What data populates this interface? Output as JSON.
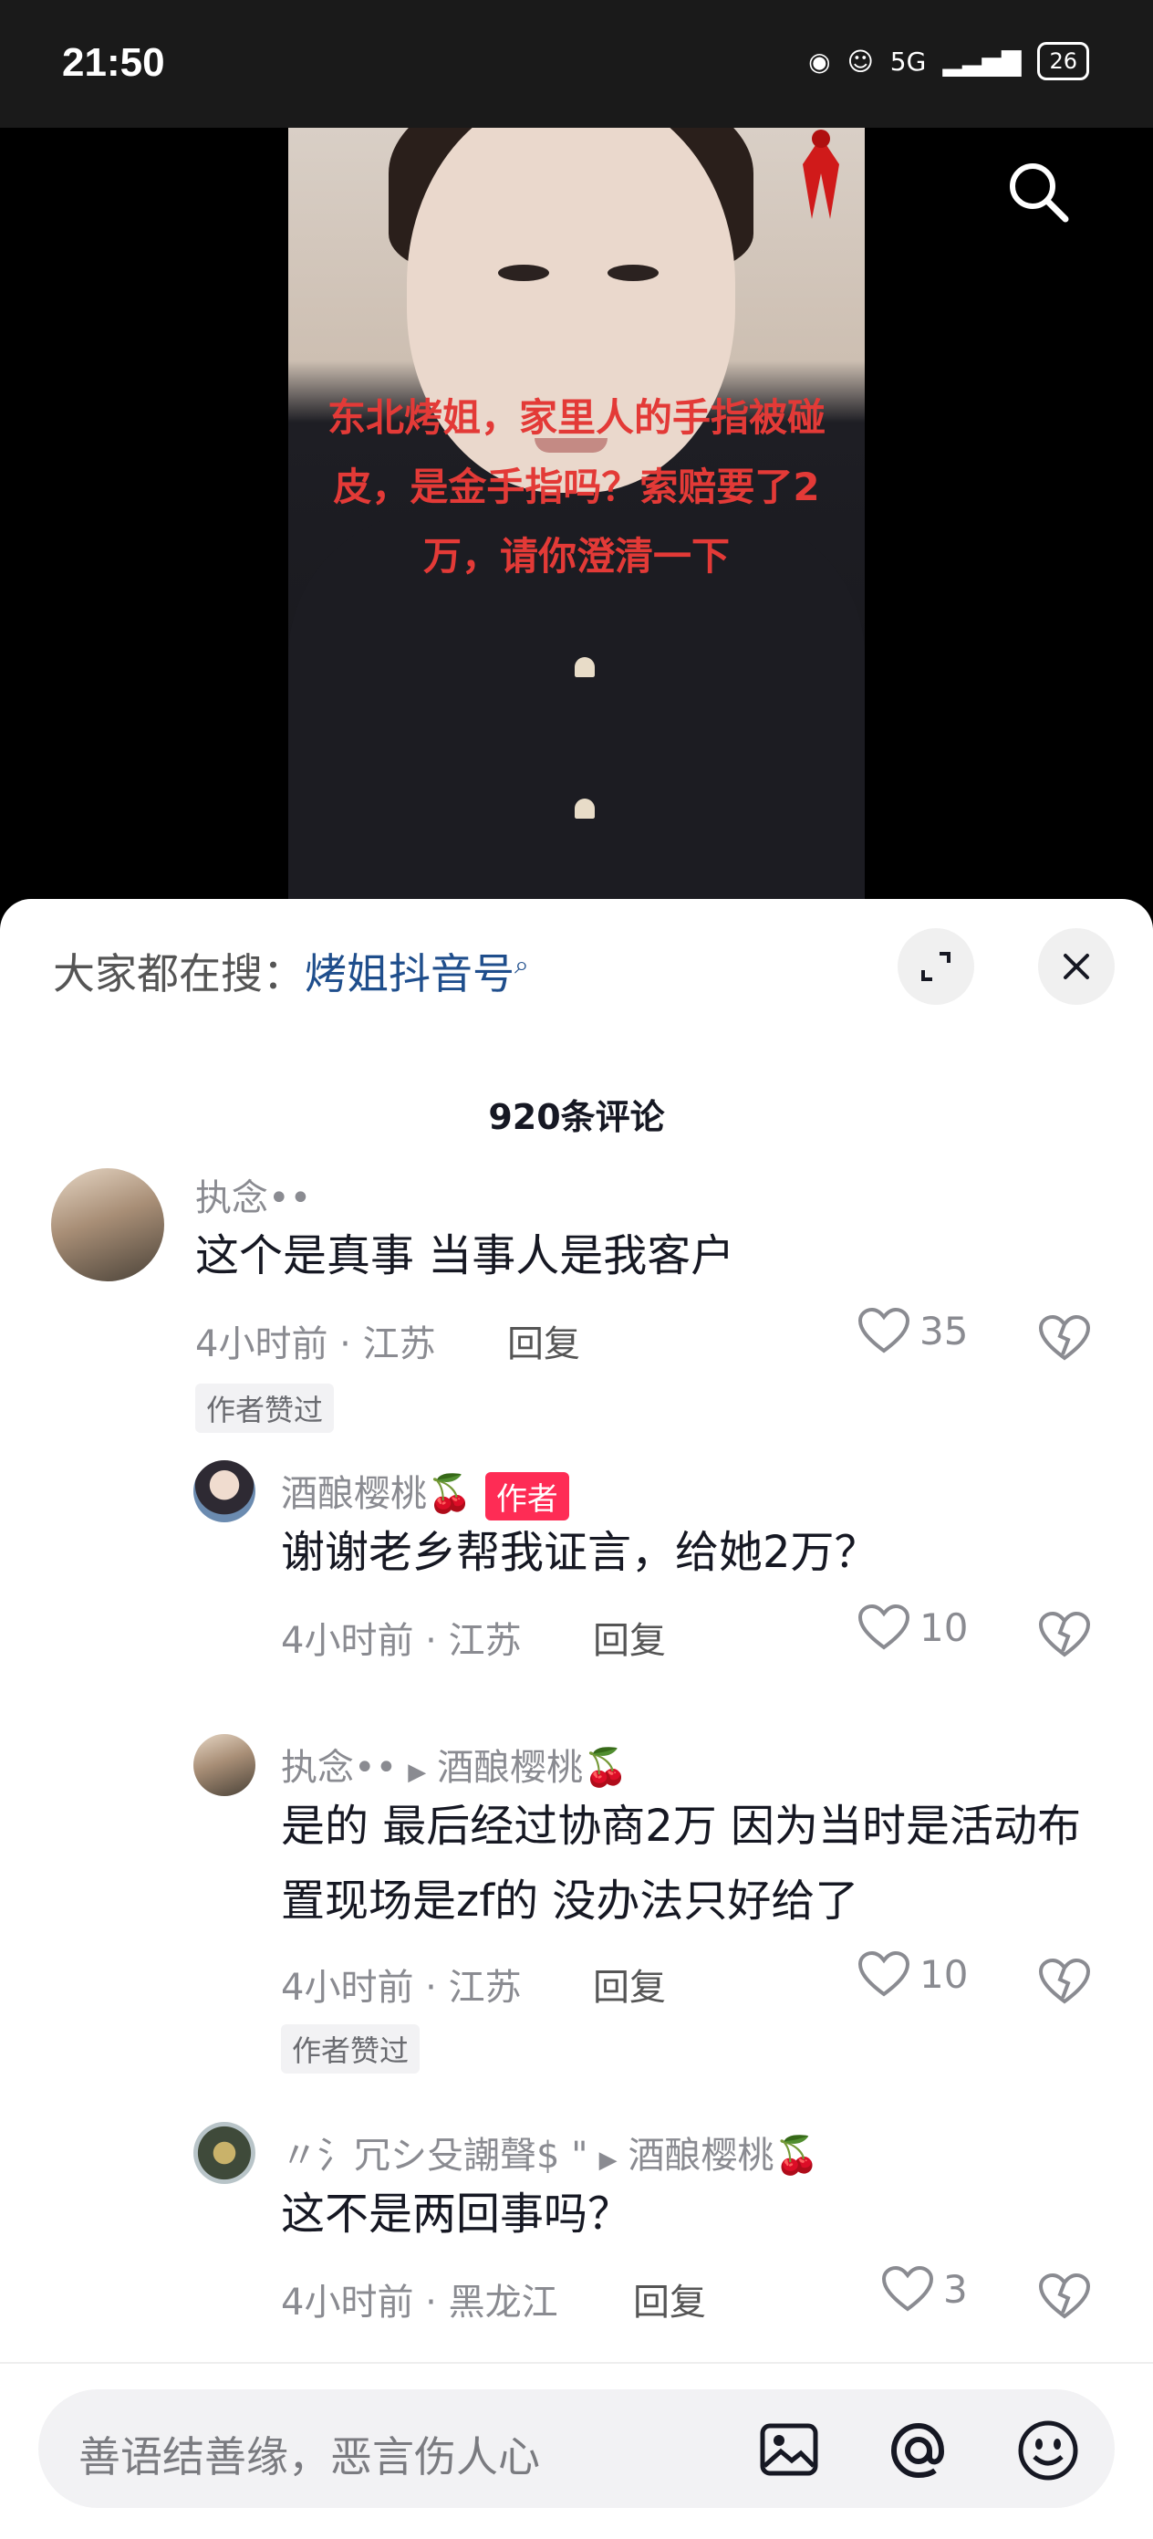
{
  "status_bar": {
    "time": "21:50",
    "icons": [
      "eye-icon",
      "cat-icon",
      "5g-signal-icon",
      "signal-bars-icon"
    ],
    "network": "5G",
    "battery": "26"
  },
  "video": {
    "overlay_text": "东北烤姐，家里人的手指被碰皮，是金手指吗？索赔要了2万，请你澄清一下"
  },
  "sheet": {
    "search_prefix": "大家都在搜：",
    "search_keyword": "烤姐抖音号",
    "comment_count": "920条评论"
  },
  "comments": [
    {
      "user": "执念••",
      "text": "这个是真事  当事人是我客户",
      "time_location": "4小时前 · 江苏",
      "reply": "回复",
      "likes": "35",
      "author_liked": "作者赞过"
    },
    {
      "user": "酒酿樱桃🍒",
      "tag": "作者",
      "text": "谢谢老乡帮我证言，给她2万？",
      "time_location": "4小时前 · 江苏",
      "reply": "回复",
      "likes": "10"
    },
    {
      "user": "执念••",
      "reply_to": "酒酿樱桃🍒",
      "text": "是的 最后经过协商2万 因为当时是活动布置现场是zf的  没办法只好给了",
      "time_location": "4小时前 · 江苏",
      "reply": "回复",
      "likes": "10",
      "author_liked": "作者赞过"
    },
    {
      "user": "〃氵冗シ殳謿聲$ \"",
      "reply_to": "酒酿樱桃🍒",
      "text": "这不是两回事吗？",
      "time_location": "4小时前 · 黑龙江",
      "reply": "回复",
      "likes": "3"
    }
  ],
  "input": {
    "placeholder": "善语结善缘，恶言伤人心"
  }
}
